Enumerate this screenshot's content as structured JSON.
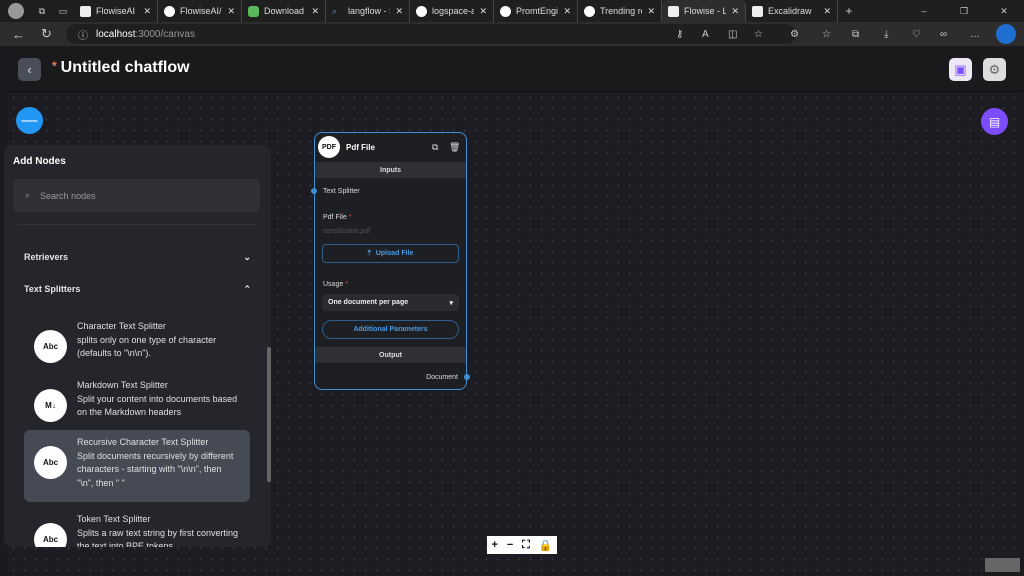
{
  "browser": {
    "tabs": [
      {
        "label": "FlowiseAI - B",
        "icon": "page-icon"
      },
      {
        "label": "FlowiseAI/Flo",
        "icon": "github-icon"
      },
      {
        "label": "Download | N",
        "icon": "nodejs-icon"
      },
      {
        "label": "langflow - Se",
        "icon": "search-icon"
      },
      {
        "label": "logspace-ai/l",
        "icon": "github-icon"
      },
      {
        "label": "PromtEngine",
        "icon": "github-icon"
      },
      {
        "label": "Trending rep",
        "icon": "github-icon"
      },
      {
        "label": "Flowise - Lan",
        "icon": "page-icon",
        "active": true
      },
      {
        "label": "Excalidraw",
        "icon": "page-icon"
      }
    ],
    "url_host": "localhost",
    "url_path": ":3000/canvas"
  },
  "header": {
    "unsaved_marker": "*",
    "title": "Untitled chatflow"
  },
  "add_nodes": {
    "title": "Add Nodes",
    "search_placeholder": "Search nodes",
    "categories": [
      {
        "label": "Retrievers",
        "expanded": false
      },
      {
        "label": "Text Splitters",
        "expanded": true
      }
    ],
    "items": [
      {
        "name": "Character Text Splitter",
        "desc": "splits only on one type of character (defaults to \"\\n\\n\").",
        "icon": "Abc"
      },
      {
        "name": "Markdown Text Splitter",
        "desc": "Split your content into documents based on the Markdown headers",
        "icon": "M↓"
      },
      {
        "name": "Recursive Character Text Splitter",
        "desc": "Split documents recursively by different characters - starting with \"\\n\\n\", then \"\\n\", then \" \"",
        "icon": "Abc"
      },
      {
        "name": "Token Text Splitter",
        "desc": "Splits a raw text string by first converting the text into BPE tokens",
        "icon": "Abc"
      }
    ]
  },
  "node": {
    "icon": "PDF",
    "title": "Pdf File",
    "inputs_label": "Inputs",
    "text_splitter_label": "Text Splitter",
    "pdf_file_label": "Pdf File",
    "pdf_file_value": "constitution.pdf",
    "upload_label": "Upload File",
    "usage_label": "Usage",
    "usage_value": "One document per page",
    "additional_label": "Additional Parameters",
    "output_label": "Output",
    "document_label": "Document"
  },
  "colors": {
    "accent": "#2196f3",
    "purple": "#7c4dff"
  }
}
